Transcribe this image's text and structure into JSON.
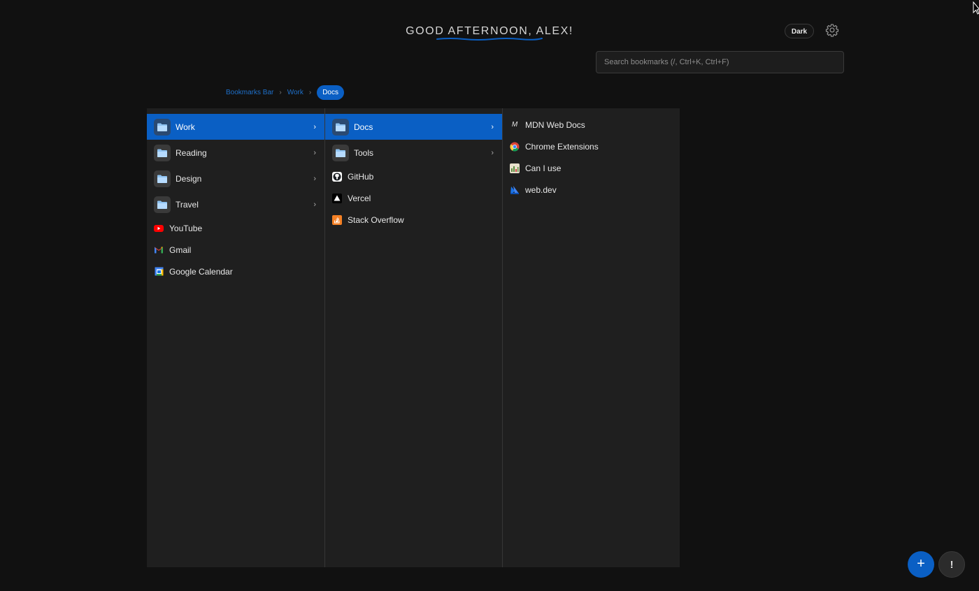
{
  "header": {
    "greeting": "GOOD AFTERNOON, ALEX!",
    "theme_label": "Dark"
  },
  "search": {
    "placeholder": "Search bookmarks (/, Ctrl+K, Ctrl+F)"
  },
  "breadcrumb": {
    "items": [
      "Bookmarks Bar",
      "Work"
    ],
    "active": "Docs"
  },
  "columns": {
    "col1": {
      "folders": [
        {
          "label": "Work",
          "selected": true
        },
        {
          "label": "Reading"
        },
        {
          "label": "Design"
        },
        {
          "label": "Travel"
        }
      ],
      "links": [
        {
          "label": "YouTube",
          "icon": "youtube-icon"
        },
        {
          "label": "Gmail",
          "icon": "gmail-icon"
        },
        {
          "label": "Google Calendar",
          "icon": "calendar-icon"
        }
      ]
    },
    "col2": {
      "folders": [
        {
          "label": "Docs",
          "selected": true
        },
        {
          "label": "Tools"
        }
      ],
      "links": [
        {
          "label": "GitHub",
          "icon": "github-icon"
        },
        {
          "label": "Vercel",
          "icon": "vercel-icon"
        },
        {
          "label": "Stack Overflow",
          "icon": "stackoverflow-icon"
        }
      ]
    },
    "col3": {
      "links": [
        {
          "label": "MDN Web Docs",
          "icon": "mdn-icon"
        },
        {
          "label": "Chrome Extensions",
          "icon": "chrome-icon"
        },
        {
          "label": "Can I use",
          "icon": "caniuse-icon"
        },
        {
          "label": "web.dev",
          "icon": "webdev-icon"
        }
      ]
    }
  },
  "fab": {
    "add_label": "+",
    "info_label": "!"
  },
  "colors": {
    "accent": "#0a5fc4",
    "background": "#111111",
    "panel": "#1f1f1f"
  }
}
